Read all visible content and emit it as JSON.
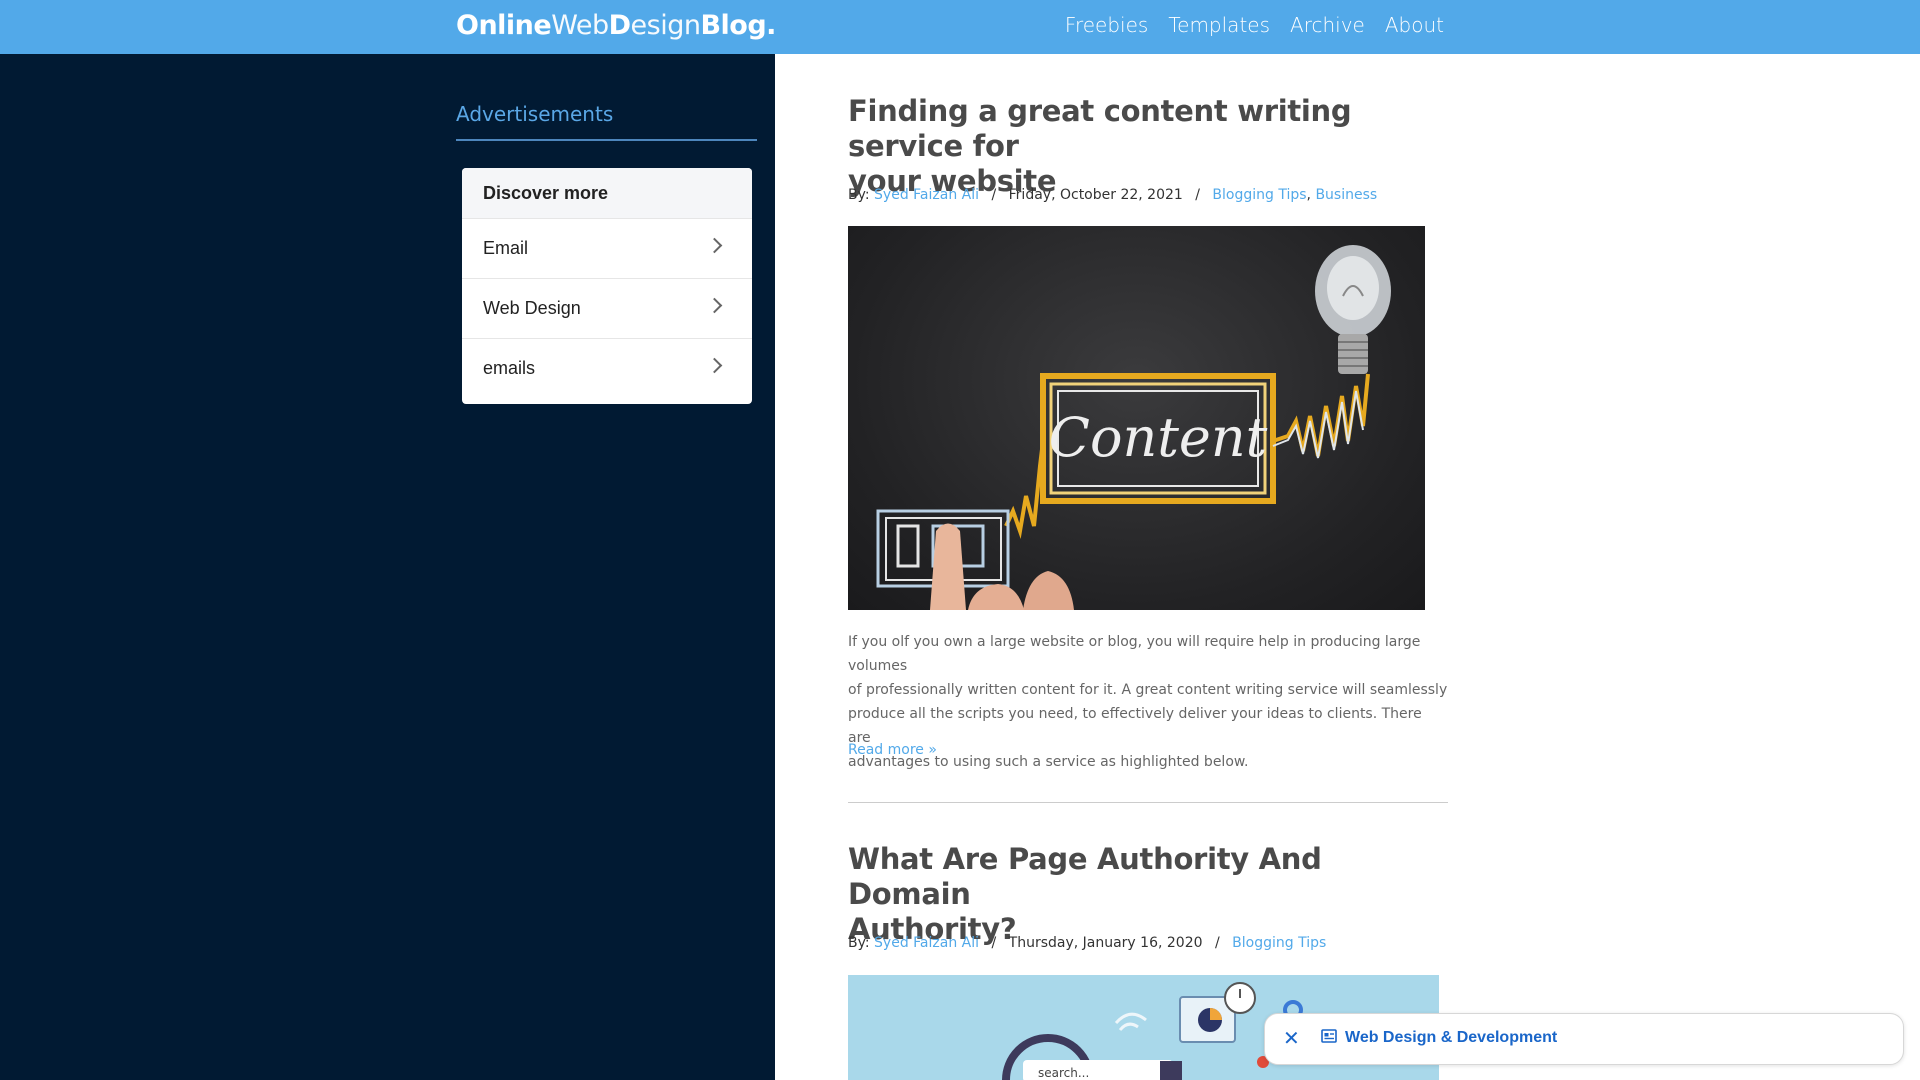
{
  "header": {
    "logo": {
      "part1": "Online",
      "part2": "Web",
      "part3": "D",
      "part4": "esign",
      "part5": "Blog."
    },
    "nav": [
      "Freebies",
      "Templates",
      "Archive",
      "About"
    ]
  },
  "sidebar": {
    "title": "Advertisements",
    "discover": {
      "heading": "Discover more",
      "items": [
        "Email",
        "Web Design",
        "emails"
      ]
    }
  },
  "posts": [
    {
      "title_line1": "Finding a great content writing service for",
      "title_line2": "your website",
      "by": "By:",
      "author": "Syed Faizan Ali",
      "date": "Friday, October 22, 2021",
      "categories": [
        "Blogging Tips",
        "Business"
      ],
      "image_word": "Content",
      "excerpt_lines": [
        "If you olf you own a large website or blog, you will require help in producing large volumes",
        "of professionally written content for it. A great content writing service will seamlessly",
        "produce all the scripts you need, to effectively deliver your ideas to clients. There are",
        "advantages to using such a service as highlighted below."
      ],
      "read_more": "Read more »"
    },
    {
      "title_line1": "What Are Page Authority And Domain",
      "title_line2": "Authority?",
      "by": "By:",
      "author": "Syed Faizan Ali",
      "date": "Thursday, January 16, 2020",
      "categories": [
        "Blogging Tips"
      ],
      "image_text": "search..."
    }
  ],
  "chip": {
    "label": "Web Design & Development"
  },
  "colors": {
    "header": "#52a9e9",
    "sidebar": "#011a33",
    "link": "#52a9e9",
    "chip_text": "#1a66c9"
  }
}
